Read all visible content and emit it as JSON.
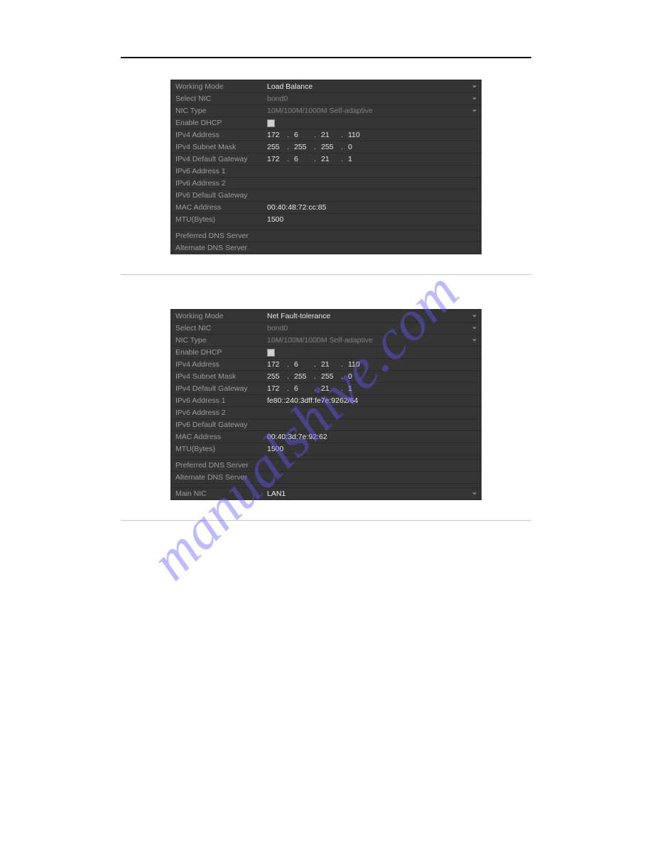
{
  "watermark": "manualshive.com",
  "panel1": {
    "rows": [
      {
        "label": "Working Mode",
        "kind": "select",
        "value": "Load Balance"
      },
      {
        "label": "Select NIC",
        "kind": "select",
        "value": "bond0",
        "dim": true
      },
      {
        "label": "NIC Type",
        "kind": "select",
        "value": "10M/100M/1000M Self-adaptive",
        "dim": true
      },
      {
        "label": "Enable DHCP",
        "kind": "checkbox",
        "checked": false
      },
      {
        "label": "IPv4 Address",
        "kind": "ip",
        "octets": [
          "172",
          "6",
          "21",
          "110"
        ]
      },
      {
        "label": "IPv4 Subnet Mask",
        "kind": "ip",
        "octets": [
          "255",
          "255",
          "255",
          "0"
        ]
      },
      {
        "label": "IPv4 Default Gateway",
        "kind": "ip",
        "octets": [
          "172",
          "6",
          "21",
          "1"
        ]
      },
      {
        "label": "IPv6 Address 1",
        "kind": "text",
        "value": ""
      },
      {
        "label": "IPv6 Address 2",
        "kind": "text",
        "value": ""
      },
      {
        "label": "IPv6 Default Gateway",
        "kind": "text",
        "value": ""
      },
      {
        "label": "MAC Address",
        "kind": "text",
        "value": "00:40:48:72:cc:85"
      },
      {
        "label": "MTU(Bytes)",
        "kind": "text",
        "value": "1500"
      },
      {
        "label": "",
        "kind": "gap"
      },
      {
        "label": "Preferred DNS Server",
        "kind": "text",
        "value": ""
      },
      {
        "label": "Alternate DNS Server",
        "kind": "text",
        "value": ""
      }
    ]
  },
  "panel2": {
    "rows": [
      {
        "label": "Working Mode",
        "kind": "select",
        "value": "Net Fault-tolerance"
      },
      {
        "label": "Select NIC",
        "kind": "select",
        "value": "bond0",
        "dim": true
      },
      {
        "label": "NIC Type",
        "kind": "select",
        "value": "10M/100M/1000M Self-adaptive",
        "dim": true
      },
      {
        "label": "Enable DHCP",
        "kind": "checkbox",
        "checked": false
      },
      {
        "label": "IPv4 Address",
        "kind": "ip",
        "octets": [
          "172",
          "6",
          "21",
          "110"
        ]
      },
      {
        "label": "IPv4 Subnet Mask",
        "kind": "ip",
        "octets": [
          "255",
          "255",
          "255",
          "0"
        ]
      },
      {
        "label": "IPv4 Default Gateway",
        "kind": "ip",
        "octets": [
          "172",
          "6",
          "21",
          "1"
        ]
      },
      {
        "label": "IPv6 Address 1",
        "kind": "text",
        "value": "fe80::240:3dff:fe7e:9262/64"
      },
      {
        "label": "IPv6 Address 2",
        "kind": "text",
        "value": ""
      },
      {
        "label": "IPv6 Default Gateway",
        "kind": "text",
        "value": ""
      },
      {
        "label": "MAC Address",
        "kind": "text",
        "value": "00:40:3d:7e:92:62"
      },
      {
        "label": "MTU(Bytes)",
        "kind": "text",
        "value": "1500"
      },
      {
        "label": "",
        "kind": "gap"
      },
      {
        "label": "Preferred DNS Server",
        "kind": "text",
        "value": ""
      },
      {
        "label": "Alternate DNS Server",
        "kind": "text",
        "value": ""
      },
      {
        "label": "",
        "kind": "gap"
      },
      {
        "label": "Main NIC",
        "kind": "select",
        "value": "LAN1"
      }
    ]
  }
}
